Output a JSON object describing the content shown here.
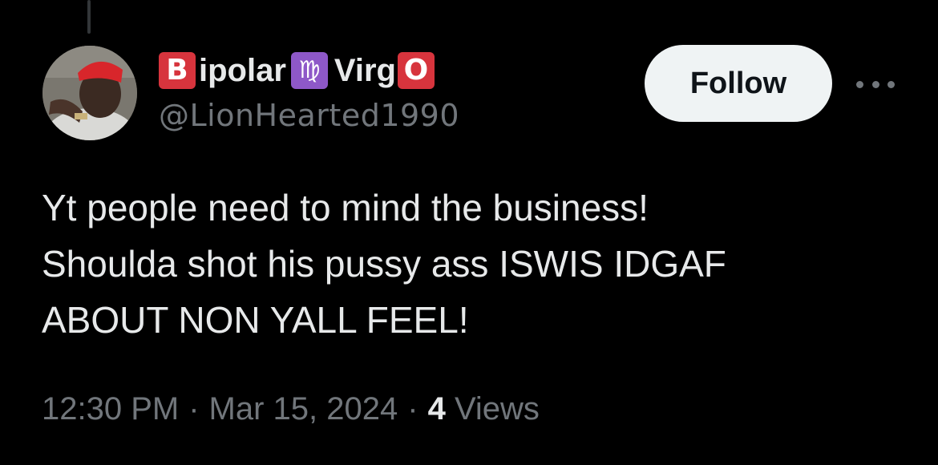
{
  "author": {
    "name_part1_boxed": "B",
    "name_part1_rest": "ipolar",
    "zodiac_symbol": "♍",
    "name_part2": "Virg",
    "name_part2_boxed": "O",
    "handle": "@LionHearted1990"
  },
  "actions": {
    "follow_label": "Follow"
  },
  "tweet": {
    "lines": [
      "Yt people need to mind the business!",
      "Shoulda shot his pussy ass ISWIS IDGAF",
      "ABOUT NON YALL FEEL!"
    ]
  },
  "meta": {
    "time": "12:30 PM",
    "separator": "·",
    "date": "Mar 15, 2024",
    "views_count": "4",
    "views_label": "Views"
  },
  "colors": {
    "background": "#000000",
    "text_primary": "#e7e9ea",
    "text_secondary": "#71767b",
    "follow_bg": "#eff3f4",
    "emoji_red": "#d7343d",
    "emoji_purple": "#8e58c8"
  },
  "icons": {
    "more": "more-horizontal-icon"
  }
}
